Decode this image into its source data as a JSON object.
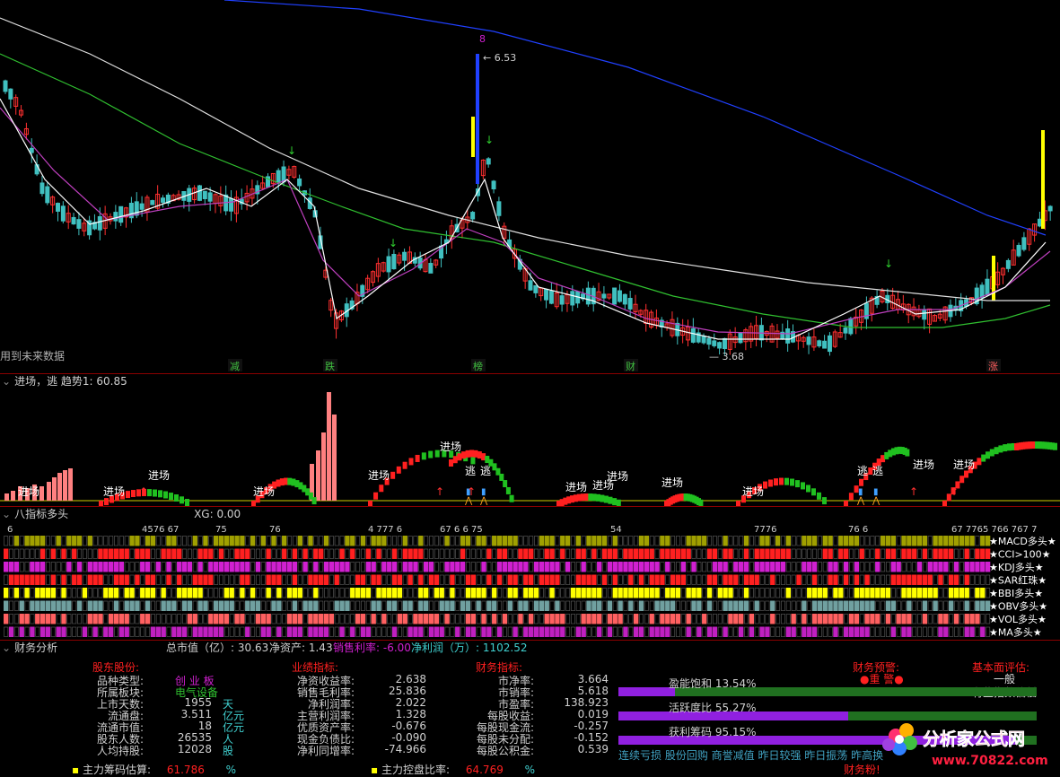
{
  "main": {
    "note": "用到未来数据",
    "labels": {
      "high": "6.53",
      "low": "3.68",
      "peak_count": "8"
    },
    "markers": [
      "减",
      "跌",
      "榜",
      "财",
      "涨"
    ],
    "up_color": "#ff3030",
    "down_color": "#40c0c0"
  },
  "pane2": {
    "title": "进场，逃  趋势1: 60.85",
    "enter_label": "进场",
    "escape_label": "逃"
  },
  "pane3": {
    "title": "八指标多头",
    "xg": "XG: 0.00",
    "rows": [
      "MACD多头",
      "CCI>100",
      "KDJ多头",
      "SAR红珠",
      "BBI多头",
      "OBV多头",
      "VOL多头",
      "MA多头"
    ],
    "row_colors": [
      "#a0a000",
      "#ff2020",
      "#d020d0",
      "#ff2020",
      "#ffff00",
      "#70a0a0",
      "#ff6060",
      "#c020c0"
    ],
    "legend_star": "★"
  },
  "finance": {
    "title": "财务分析",
    "summary": {
      "total_cap_label": "总市值（亿）: 30.63",
      "net_assets_label": "净资产: 1.43",
      "margin_label": "销售利率: -6.00",
      "profit_label": "净利润（万）: 1102.52"
    },
    "sections": {
      "holders": "股东股份:",
      "performance": "业绩指标:",
      "financial": "财务指标:",
      "warning": "财务预警:",
      "basic": "基本面评估:"
    },
    "holders": [
      {
        "label": "品种类型:",
        "value": "创 业 板"
      },
      {
        "label": "所属板块:",
        "value": "电气设备"
      },
      {
        "label": "上市天数:",
        "value": "1955",
        "unit": "天"
      },
      {
        "label": "流通盘:",
        "value": "3.511",
        "unit": "亿元"
      },
      {
        "label": "流通市值:",
        "value": "18",
        "unit": "亿元"
      },
      {
        "label": "股东人数:",
        "value": "26535",
        "unit": "人"
      },
      {
        "label": "人均持股:",
        "value": "12028",
        "unit": "股"
      }
    ],
    "performance": [
      {
        "label": "净资收益率:",
        "value": "2.638"
      },
      {
        "label": "销售毛利率:",
        "value": "25.836"
      },
      {
        "label": "净利润率:",
        "value": "2.022"
      },
      {
        "label": "主营利润率:",
        "value": "1.328"
      },
      {
        "label": "优质资产率:",
        "value": "-0.676"
      },
      {
        "label": "现金负债比:",
        "value": "-0.090"
      },
      {
        "label": "净利同增率:",
        "value": "-74.966"
      }
    ],
    "financial": [
      {
        "label": "市净率:",
        "value": "3.664"
      },
      {
        "label": "市销率:",
        "value": "5.618"
      },
      {
        "label": "市盈率:",
        "value": "138.923"
      },
      {
        "label": "每股收益:",
        "value": "0.019"
      },
      {
        "label": "每股现金流:",
        "value": "-0.257"
      },
      {
        "label": "每股未分配:",
        "value": "-0.152"
      },
      {
        "label": "每股公积金:",
        "value": "0.539"
      }
    ],
    "warning_value": "●重 警●",
    "basic_value": "一般",
    "basic_note": "有些指数偏低",
    "gauges": [
      {
        "label": "盈能饱和 13.54%",
        "fill": 0.135
      },
      {
        "label": "活跃度比 55.27%",
        "fill": 0.55
      },
      {
        "label": "获利筹码 95.15%",
        "fill": 0.95
      }
    ],
    "main_chip_label": "主力筹码估算:",
    "main_chip_value": "61.786",
    "main_chip_unit": "%",
    "main_control_label": "主力控盘比率:",
    "main_control_value": "64.769",
    "main_control_unit": "%",
    "status_line": "连续亏损 股份回购 商誉减值 昨日较强 昨日振荡 昨高换",
    "audit_label": "财务粉!"
  },
  "watermark": {
    "line1": "分析家公式网",
    "line2": "www.70822.com"
  }
}
